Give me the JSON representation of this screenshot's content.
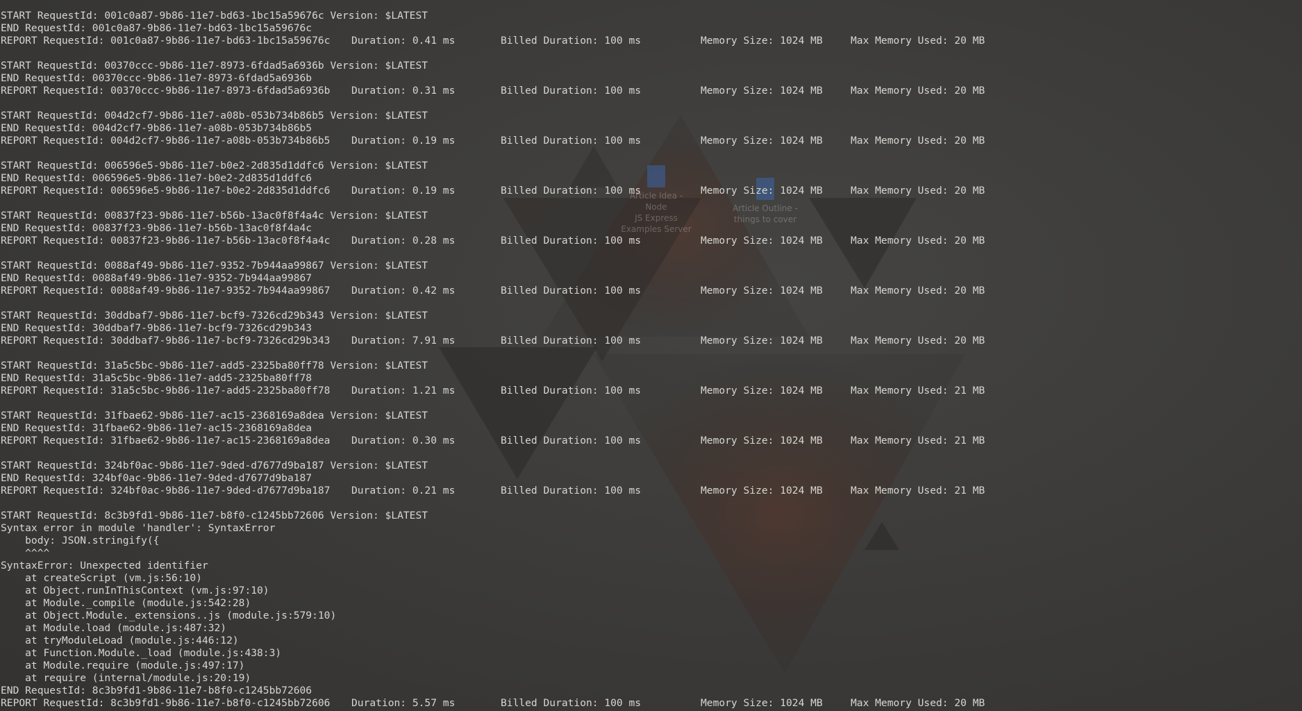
{
  "desktop": {
    "icons": [
      {
        "label_lines": [
          "Article Idea - Node",
          "JS Express",
          "Examples Server"
        ]
      },
      {
        "label_lines": [
          "Article Outline -",
          "things to cover"
        ]
      }
    ]
  },
  "terminal": {
    "requests": [
      {
        "start": "START RequestId: 001c0a87-9b86-11e7-bd63-1bc15a59676c Version: $LATEST",
        "end": "END RequestId: 001c0a87-9b86-11e7-bd63-1bc15a59676c",
        "report_id": "REPORT RequestId: 001c0a87-9b86-11e7-bd63-1bc15a59676c",
        "duration": "Duration: 0.41 ms",
        "billed": "Billed Duration: 100 ms",
        "memory": "Memory Size: 1024 MB",
        "max_memory": "Max Memory Used: 20 MB"
      },
      {
        "start": "START RequestId: 00370ccc-9b86-11e7-8973-6fdad5a6936b Version: $LATEST",
        "end": "END RequestId: 00370ccc-9b86-11e7-8973-6fdad5a6936b",
        "report_id": "REPORT RequestId: 00370ccc-9b86-11e7-8973-6fdad5a6936b",
        "duration": "Duration: 0.31 ms",
        "billed": "Billed Duration: 100 ms",
        "memory": "Memory Size: 1024 MB",
        "max_memory": "Max Memory Used: 20 MB"
      },
      {
        "start": "START RequestId: 004d2cf7-9b86-11e7-a08b-053b734b86b5 Version: $LATEST",
        "end": "END RequestId: 004d2cf7-9b86-11e7-a08b-053b734b86b5",
        "report_id": "REPORT RequestId: 004d2cf7-9b86-11e7-a08b-053b734b86b5",
        "duration": "Duration: 0.19 ms",
        "billed": "Billed Duration: 100 ms",
        "memory": "Memory Size: 1024 MB",
        "max_memory": "Max Memory Used: 20 MB"
      },
      {
        "start": "START RequestId: 006596e5-9b86-11e7-b0e2-2d835d1ddfc6 Version: $LATEST",
        "end": "END RequestId: 006596e5-9b86-11e7-b0e2-2d835d1ddfc6",
        "report_id": "REPORT RequestId: 006596e5-9b86-11e7-b0e2-2d835d1ddfc6",
        "duration": "Duration: 0.19 ms",
        "billed": "Billed Duration: 100 ms",
        "memory": "Memory Size: 1024 MB",
        "max_memory": "Max Memory Used: 20 MB"
      },
      {
        "start": "START RequestId: 00837f23-9b86-11e7-b56b-13ac0f8f4a4c Version: $LATEST",
        "end": "END RequestId: 00837f23-9b86-11e7-b56b-13ac0f8f4a4c",
        "report_id": "REPORT RequestId: 00837f23-9b86-11e7-b56b-13ac0f8f4a4c",
        "duration": "Duration: 0.28 ms",
        "billed": "Billed Duration: 100 ms",
        "memory": "Memory Size: 1024 MB",
        "max_memory": "Max Memory Used: 20 MB"
      },
      {
        "start": "START RequestId: 0088af49-9b86-11e7-9352-7b944aa99867 Version: $LATEST",
        "end": "END RequestId: 0088af49-9b86-11e7-9352-7b944aa99867",
        "report_id": "REPORT RequestId: 0088af49-9b86-11e7-9352-7b944aa99867",
        "duration": "Duration: 0.42 ms",
        "billed": "Billed Duration: 100 ms",
        "memory": "Memory Size: 1024 MB",
        "max_memory": "Max Memory Used: 20 MB"
      },
      {
        "start": "START RequestId: 30ddbaf7-9b86-11e7-bcf9-7326cd29b343 Version: $LATEST",
        "end": "END RequestId: 30ddbaf7-9b86-11e7-bcf9-7326cd29b343",
        "report_id": "REPORT RequestId: 30ddbaf7-9b86-11e7-bcf9-7326cd29b343",
        "duration": "Duration: 7.91 ms",
        "billed": "Billed Duration: 100 ms",
        "memory": "Memory Size: 1024 MB",
        "max_memory": "Max Memory Used: 20 MB"
      },
      {
        "start": "START RequestId: 31a5c5bc-9b86-11e7-add5-2325ba80ff78 Version: $LATEST",
        "end": "END RequestId: 31a5c5bc-9b86-11e7-add5-2325ba80ff78",
        "report_id": "REPORT RequestId: 31a5c5bc-9b86-11e7-add5-2325ba80ff78",
        "duration": "Duration: 1.21 ms",
        "billed": "Billed Duration: 100 ms",
        "memory": "Memory Size: 1024 MB",
        "max_memory": "Max Memory Used: 21 MB"
      },
      {
        "start": "START RequestId: 31fbae62-9b86-11e7-ac15-2368169a8dea Version: $LATEST",
        "end": "END RequestId: 31fbae62-9b86-11e7-ac15-2368169a8dea",
        "report_id": "REPORT RequestId: 31fbae62-9b86-11e7-ac15-2368169a8dea",
        "duration": "Duration: 0.30 ms",
        "billed": "Billed Duration: 100 ms",
        "memory": "Memory Size: 1024 MB",
        "max_memory": "Max Memory Used: 21 MB"
      },
      {
        "start": "START RequestId: 324bf0ac-9b86-11e7-9ded-d7677d9ba187 Version: $LATEST",
        "end": "END RequestId: 324bf0ac-9b86-11e7-9ded-d7677d9ba187",
        "report_id": "REPORT RequestId: 324bf0ac-9b86-11e7-9ded-d7677d9ba187",
        "duration": "Duration: 0.21 ms",
        "billed": "Billed Duration: 100 ms",
        "memory": "Memory Size: 1024 MB",
        "max_memory": "Max Memory Used: 21 MB"
      }
    ],
    "final": {
      "start": "START RequestId: 8c3b9fd1-9b86-11e7-b8f0-c1245bb72606 Version: $LATEST",
      "error_lines": [
        "Syntax error in module 'handler': SyntaxError",
        "    body: JSON.stringify({",
        "    ^^^^",
        "SyntaxError: Unexpected identifier",
        "    at createScript (vm.js:56:10)",
        "    at Object.runInThisContext (vm.js:97:10)",
        "    at Module._compile (module.js:542:28)",
        "    at Object.Module._extensions..js (module.js:579:10)",
        "    at Module.load (module.js:487:32)",
        "    at tryModuleLoad (module.js:446:12)",
        "    at Function.Module._load (module.js:438:3)",
        "    at Module.require (module.js:497:17)",
        "    at require (internal/module.js:20:19)"
      ],
      "end": "END RequestId: 8c3b9fd1-9b86-11e7-b8f0-c1245bb72606",
      "report_id": "REPORT RequestId: 8c3b9fd1-9b86-11e7-b8f0-c1245bb72606",
      "duration": "Duration: 5.57 ms",
      "billed": "Billed Duration: 100 ms",
      "memory": "Memory Size: 1024 MB",
      "max_memory": "Max Memory Used: 20 MB"
    }
  }
}
